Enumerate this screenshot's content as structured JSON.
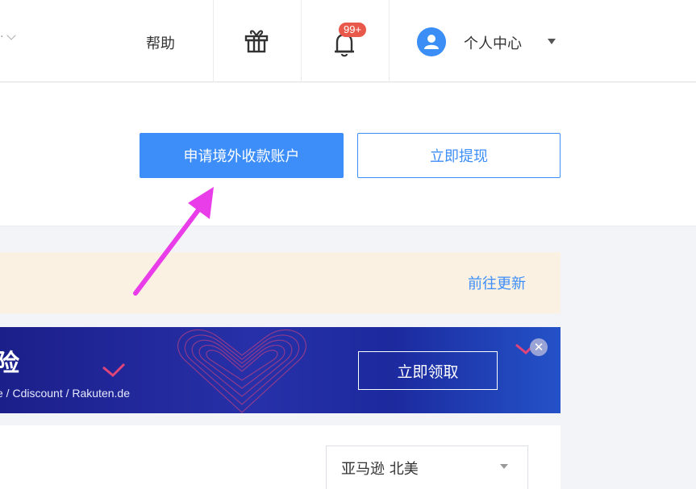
{
  "nav": {
    "help_label": "帮助",
    "badge_count": "99+",
    "user_center_label": "个人中心",
    "icons": {
      "dropdown": "chevron-down-icon",
      "gift": "gift-icon",
      "bell": "bell-icon",
      "avatar": "user-avatar-icon",
      "menu_caret": "caret-down-icon"
    }
  },
  "actions": {
    "apply_account_label": "申请境外收款账户",
    "withdraw_label": "立即提现",
    "annotation_arrow_color": "#e83de8"
  },
  "notice": {
    "link_label": "前往更新"
  },
  "banner": {
    "title": "险",
    "subtitle": "e / Cdiscount / Rakuten.de",
    "cta_label": "立即领取",
    "close_icon": "close-icon"
  },
  "filter": {
    "marketplace_value": "亚马逊 北美"
  },
  "colors": {
    "primary": "#3d8ef8",
    "badge": "#e8584b",
    "notice_bg": "#fbf1e2",
    "banner_bg": "#1f2a9e"
  }
}
